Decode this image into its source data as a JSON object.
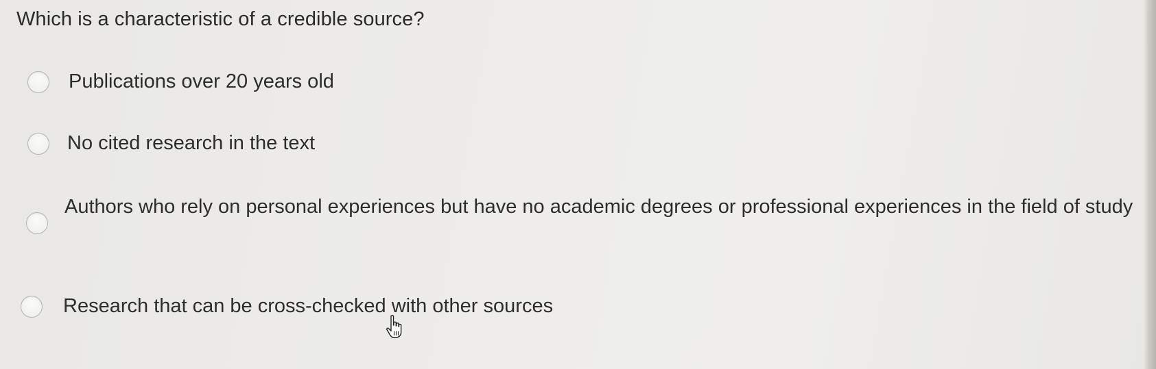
{
  "question": {
    "text": "Which is a characteristic of a credible source?"
  },
  "options": [
    {
      "label": "Publications over 20 years old",
      "selected": false
    },
    {
      "label": "No cited research in the text",
      "selected": false
    },
    {
      "label": "Authors who rely on personal experiences but have no academic degrees or professional experiences in the field of study",
      "selected": false
    },
    {
      "label": "Research that can be cross-checked with other sources",
      "selected": false
    }
  ],
  "icons": {
    "radio": "radio-button-icon",
    "cursor": "hand-pointer-cursor-icon"
  },
  "colors": {
    "background": "#eeede9",
    "text": "#2b2b2b",
    "radio_border": "#b4b4b1"
  }
}
